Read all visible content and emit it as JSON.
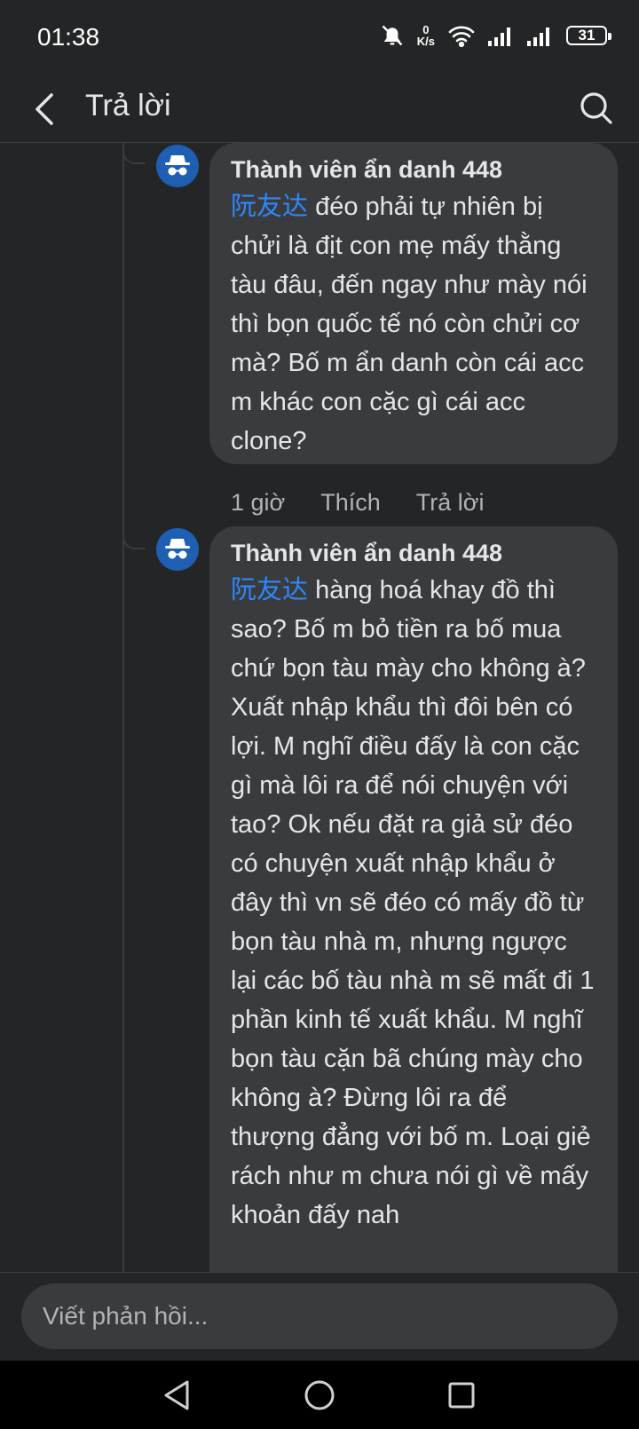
{
  "status": {
    "time": "01:38",
    "net_speed_value": "0",
    "net_speed_unit": "K/s",
    "battery": "31"
  },
  "header": {
    "title": "Trả lời"
  },
  "comments": [
    {
      "author": "Thành viên ẩn danh 448",
      "mention": "阮友达",
      "text": " đéo phải tự nhiên bị chửi là địt con mẹ mấy thằng tàu đâu, đến ngay như mày nói thì bọn quốc tế nó còn chửi cơ mà? Bố m ẩn danh còn cái acc m khác con cặc gì cái acc clone?",
      "time": "1 giờ",
      "like_label": "Thích",
      "reply_label": "Trả lời"
    },
    {
      "author": "Thành viên ẩn danh 448",
      "mention": "阮友达",
      "text": " hàng hoá khay đồ thì sao? Bố m bỏ tiền ra bố mua chứ bọn tàu mày cho không à? Xuất nhập khẩu thì đôi bên có lợi. M nghĩ điều đấy là con cặc gì mà lôi ra để nói chuyện với tao? Ok nếu đặt ra giả sử đéo có chuyện xuất nhập khẩu ở đây thì vn sẽ đéo có mấy đồ từ bọn tàu nhà m, nhưng ngược lại các bố tàu nhà m sẽ mất đi 1 phần kinh tế xuất khẩu. M nghĩ bọn tàu cặn bã chúng mày cho không à? Đừng lôi ra để thượng đẳng với bố m. Loại giẻ rách như m chưa nói gì về mấy khoản đấy nah"
    }
  ],
  "composer": {
    "placeholder": "Viết phản hồi..."
  }
}
